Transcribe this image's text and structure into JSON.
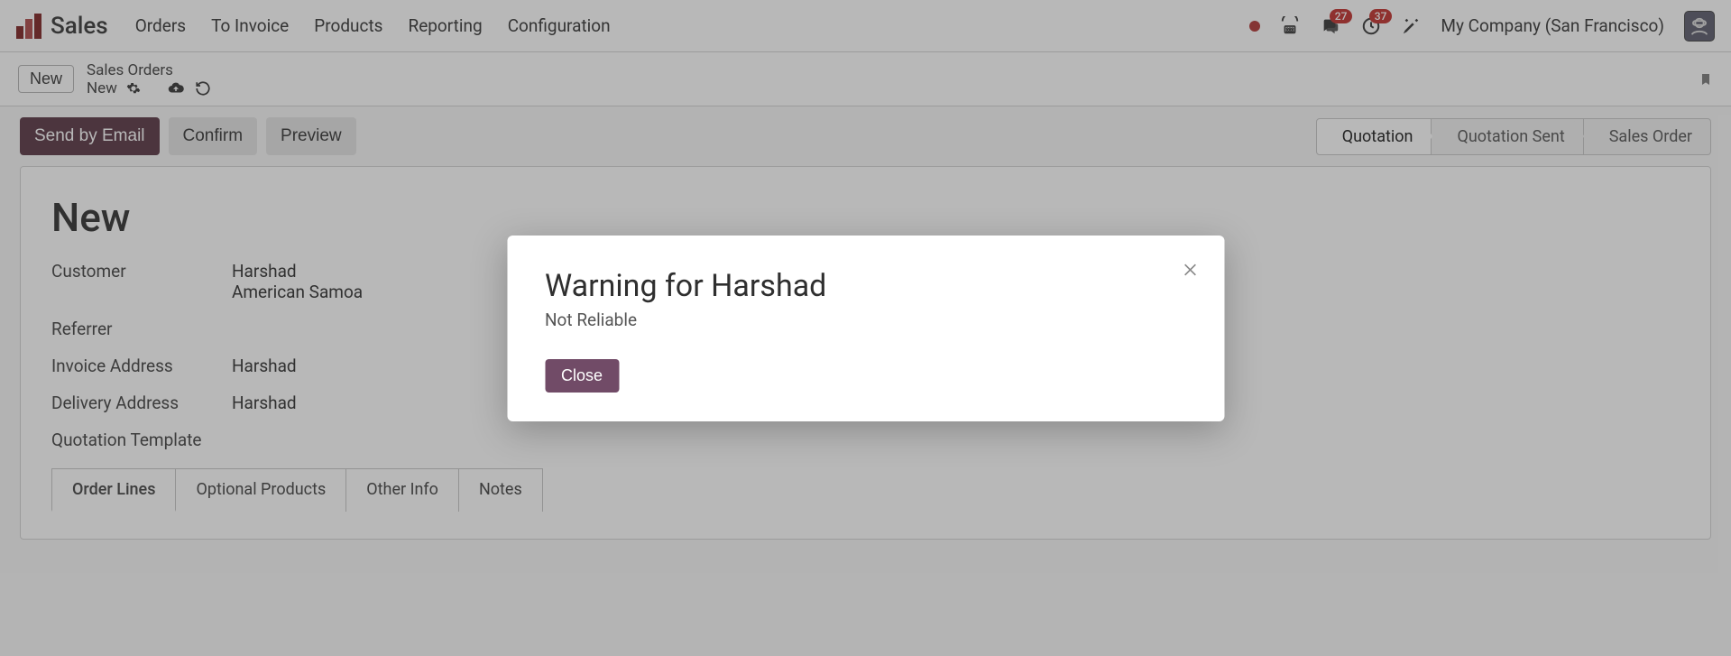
{
  "app": {
    "title": "Sales"
  },
  "nav": {
    "items": [
      "Orders",
      "To Invoice",
      "Products",
      "Reporting",
      "Configuration"
    ]
  },
  "systray": {
    "messages_badge": "27",
    "activities_badge": "37",
    "company": "My Company (San Francisco)"
  },
  "breadcrumb": {
    "new_button": "New",
    "parent": "Sales Orders",
    "current": "New"
  },
  "actions": {
    "send_email": "Send by Email",
    "confirm": "Confirm",
    "preview": "Preview"
  },
  "statusbar": [
    "Quotation",
    "Quotation Sent",
    "Sales Order"
  ],
  "form": {
    "title": "New",
    "fields": {
      "customer_label": "Customer",
      "customer_name": "Harshad",
      "customer_country": "American Samoa",
      "referrer_label": "Referrer",
      "referrer_value": "",
      "invoice_addr_label": "Invoice Address",
      "invoice_addr_value": "Harshad",
      "delivery_addr_label": "Delivery Address",
      "delivery_addr_value": "Harshad",
      "template_label": "Quotation Template",
      "template_value": ""
    },
    "tabs": [
      "Order Lines",
      "Optional Products",
      "Other Info",
      "Notes"
    ]
  },
  "modal": {
    "title": "Warning for Harshad",
    "body": "Not Reliable",
    "close": "Close"
  }
}
